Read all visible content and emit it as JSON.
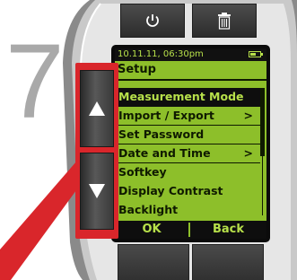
{
  "step": {
    "number": "7"
  },
  "device": {
    "top_buttons": [
      {
        "name": "power",
        "icon": "power-icon"
      },
      {
        "name": "delete",
        "icon": "trash-icon"
      }
    ],
    "nav_buttons": [
      {
        "name": "up",
        "icon": "arrow-up-icon"
      },
      {
        "name": "down",
        "icon": "arrow-down-icon"
      }
    ],
    "highlight_color": "#d9262b"
  },
  "screen": {
    "status": {
      "datetime": "10.11.11, 06:30pm",
      "battery_icon": "battery-icon",
      "battery_level": 0.6
    },
    "title": "Setup",
    "menu": [
      {
        "label": "Measurement Mode",
        "arrow": "",
        "selected": true
      },
      {
        "label": "Import / Export",
        "arrow": ">",
        "selected": false
      },
      {
        "label": "Set Password",
        "arrow": "",
        "selected": false
      },
      {
        "label": "Date and Time",
        "arrow": ">",
        "selected": false
      },
      {
        "label": "Softkey",
        "arrow": "",
        "selected": false
      },
      {
        "label": "Display Contrast",
        "arrow": "",
        "selected": false
      },
      {
        "label": "Backlight",
        "arrow": "",
        "selected": false
      }
    ],
    "softkeys": {
      "left": "OK",
      "right": "Back"
    },
    "colors": {
      "lcd_background": "#8dbf2a",
      "lcd_text": "#0f1a00",
      "lcd_inverse_text": "#b7e04a"
    }
  }
}
